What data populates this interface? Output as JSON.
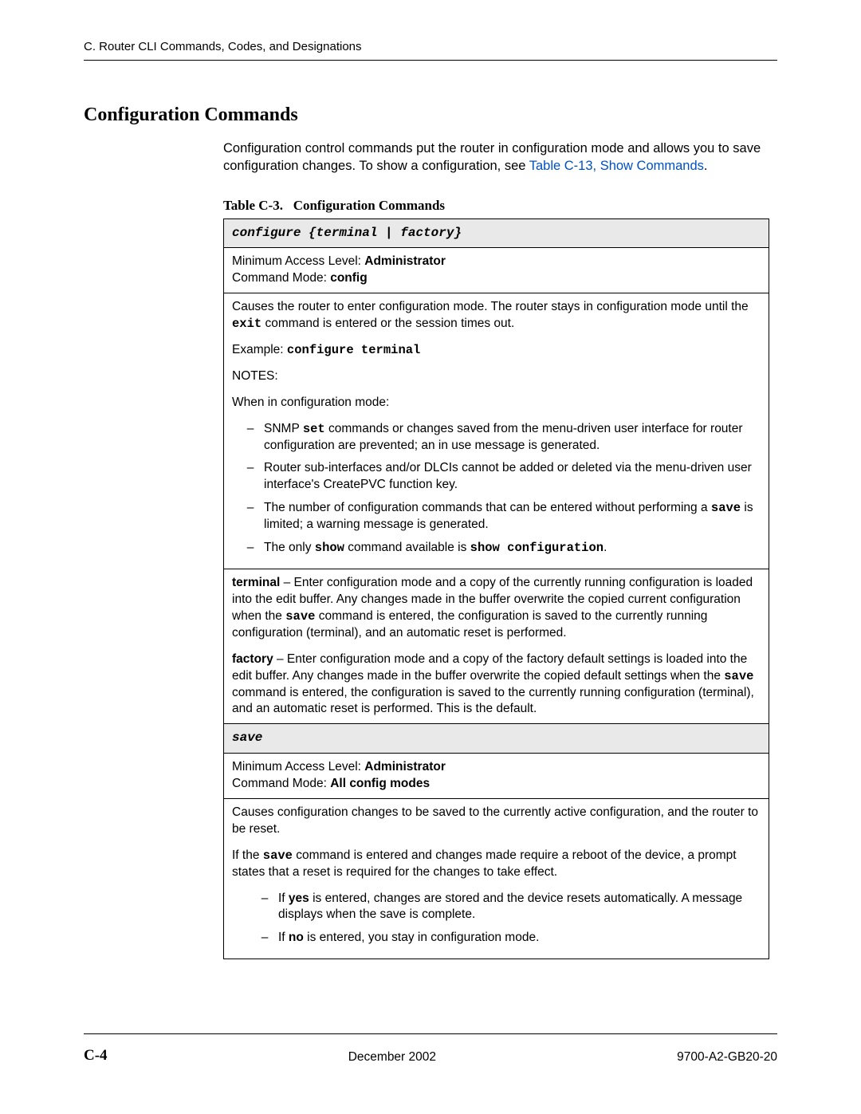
{
  "header": {
    "running": "C. Router CLI Commands, Codes, and Designations"
  },
  "section_title": "Configuration Commands",
  "intro": {
    "text": "Configuration control commands put the router in configuration mode and allows you to save configuration changes. To show a configuration, see ",
    "link": "Table C-13, Show Commands",
    "after": "."
  },
  "table": {
    "caption_prefix": "Table C-3.",
    "caption_title": "Configuration Commands",
    "commands": [
      {
        "name": "configure {terminal | factory}",
        "access_label": "Minimum Access Level: ",
        "access_value": "Administrator",
        "mode_label": "Command Mode: ",
        "mode_value": "config",
        "desc1_a": "Causes the router to enter configuration mode. The router stays in configuration mode until the ",
        "desc1_code": "exit",
        "desc1_b": " command is entered or the session times out.",
        "example_label": "Example: ",
        "example_value": "configure terminal",
        "notes_label": "NOTES:",
        "notes_intro": "When in configuration mode:",
        "bullets": [
          {
            "pre": "SNMP ",
            "code": "set",
            "post": " commands or changes saved from the menu-driven user interface for router configuration are prevented; an in use message is generated."
          },
          {
            "pre": "Router sub-interfaces and/or DLCIs cannot be added or deleted via the menu-driven user interface's CreatePVC function key.",
            "code": "",
            "post": ""
          },
          {
            "pre": "The number of configuration commands that can be entered without performing a ",
            "code": "save",
            "post": " is limited; a warning message is generated."
          },
          {
            "pre": "The only ",
            "code": "show",
            "post": " command available is ",
            "code2": "show configuration",
            "post2": "."
          }
        ],
        "terminal_label": "terminal",
        "terminal_text_a": " – Enter configuration mode and a copy of the currently running configuration is loaded into the edit buffer. Any changes made in the buffer overwrite the copied current configuration when the ",
        "terminal_code": "save",
        "terminal_text_b": " command is entered, the configuration is saved to the currently running configuration (terminal), and an automatic reset is performed.",
        "factory_label": "factory",
        "factory_text_a": " – Enter configuration mode and a copy of the factory default settings is loaded into the edit buffer. Any changes made in the buffer overwrite the copied default settings when the ",
        "factory_code": "save",
        "factory_text_b": " command is entered, the configuration is saved to the currently running configuration (terminal), and an automatic reset is performed. This is the default."
      },
      {
        "name": "save",
        "access_label": "Minimum Access Level: ",
        "access_value": "Administrator",
        "mode_label": "Command Mode: ",
        "mode_value": "All config modes",
        "desc1": "Causes configuration changes to be saved to the currently active configuration, and the router to be reset.",
        "desc2_a": "If the ",
        "desc2_code": "save",
        "desc2_b": " command is entered and changes made require a reboot of the device, a prompt states that a reset is required for the changes to take effect.",
        "bullets": [
          {
            "pre": "If ",
            "bold": "yes",
            "post": " is entered, changes are stored and the device resets automatically. A message displays when the save is complete."
          },
          {
            "pre": "If ",
            "bold": "no",
            "post": " is entered, you stay in configuration mode."
          }
        ]
      }
    ]
  },
  "footer": {
    "page_num": "C-4",
    "date": "December 2002",
    "doc_id": "9700-A2-GB20-20"
  }
}
